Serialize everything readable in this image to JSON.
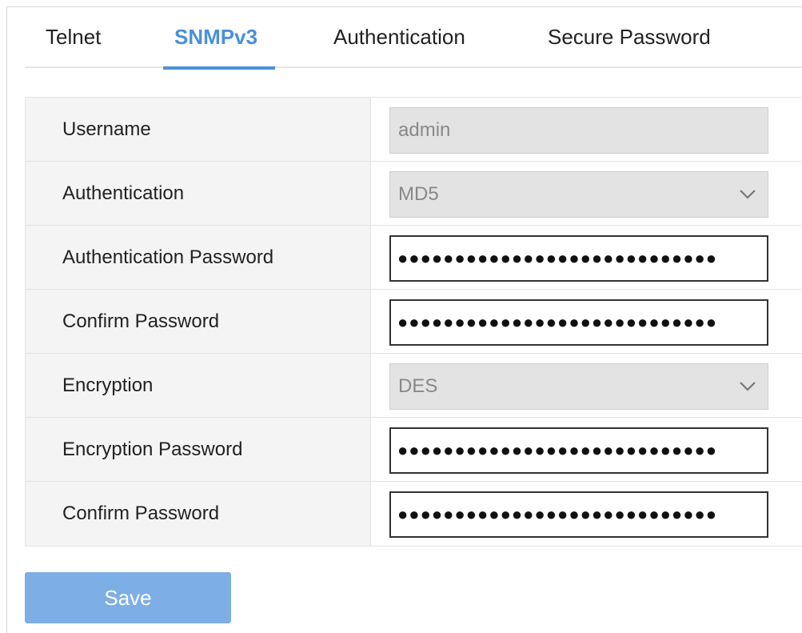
{
  "tabs": [
    {
      "label": "Telnet",
      "active": false
    },
    {
      "label": "SNMPv3",
      "active": true
    },
    {
      "label": "Authentication",
      "active": false
    },
    {
      "label": "Secure Password",
      "active": false
    }
  ],
  "form": {
    "username": {
      "label": "Username",
      "value": "admin"
    },
    "authentication": {
      "label": "Authentication",
      "value": "MD5"
    },
    "auth_password": {
      "label": "Authentication Password",
      "value": "●●●●●●●●●●●●●●●●●●●●●●●●●●●●"
    },
    "auth_confirm": {
      "label": "Confirm Password",
      "value": "●●●●●●●●●●●●●●●●●●●●●●●●●●●●"
    },
    "encryption": {
      "label": "Encryption",
      "value": "DES"
    },
    "enc_password": {
      "label": "Encryption Password",
      "value": "●●●●●●●●●●●●●●●●●●●●●●●●●●●●"
    },
    "enc_confirm": {
      "label": "Confirm Password",
      "value": "●●●●●●●●●●●●●●●●●●●●●●●●●●●●"
    }
  },
  "actions": {
    "save_label": "Save"
  },
  "colors": {
    "accent": "#4a90d9",
    "button": "#7eaee6"
  }
}
